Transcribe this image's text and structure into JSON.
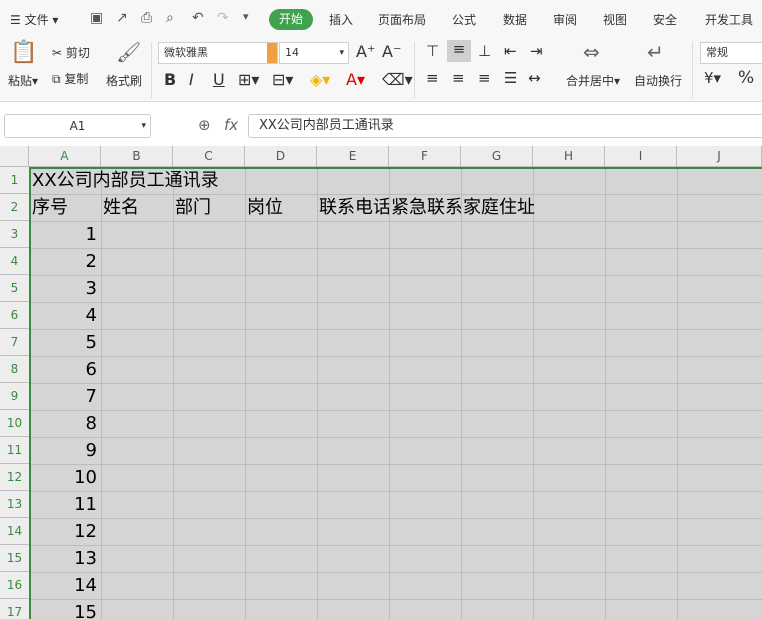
{
  "menubar": {
    "file": "文件",
    "tabs": [
      "开始",
      "插入",
      "页面布局",
      "公式",
      "数据",
      "审阅",
      "视图",
      "安全",
      "开发工具"
    ]
  },
  "ribbon": {
    "paste": "粘贴",
    "cut": "剪切",
    "copy": "复制",
    "format_painter": "格式刷",
    "font_name": "微软雅黑",
    "font_size": "14",
    "merge_center": "合并居中",
    "wrap_text": "自动换行",
    "number_format": "常规",
    "percent": "%"
  },
  "formula": {
    "cell_ref": "A1",
    "fx": "fx",
    "content": "XX公司内部员工通讯录"
  },
  "columns": [
    "A",
    "B",
    "C",
    "D",
    "E",
    "F",
    "G",
    "H",
    "I",
    "J"
  ],
  "rows": [
    "1",
    "2",
    "3",
    "4",
    "5",
    "6",
    "7",
    "8",
    "9",
    "10",
    "11",
    "12",
    "13",
    "14",
    "15",
    "16",
    "17"
  ],
  "cells": {
    "title": "XX公司内部员工通讯录",
    "headers": [
      "序号",
      "姓名",
      "部门",
      "岗位",
      "联系电话",
      "紧急联系",
      "家庭住址"
    ],
    "serials": [
      "1",
      "2",
      "3",
      "4",
      "5",
      "6",
      "7",
      "8",
      "9",
      "10",
      "11",
      "12",
      "13",
      "14",
      "15"
    ]
  }
}
